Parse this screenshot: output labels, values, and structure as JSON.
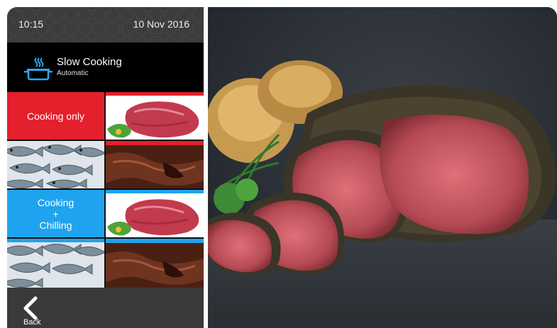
{
  "status": {
    "time": "10:15",
    "date": "10 Nov 2016"
  },
  "mode": {
    "icon": "pot-steam-icon",
    "title": "Slow Cooking",
    "subtitle": "Automatic"
  },
  "programs": [
    {
      "label": "Cooking only",
      "color": "#e3202c"
    },
    {
      "label_lines": [
        "Cooking",
        "+",
        "Chilling"
      ],
      "color": "#1fa3ef"
    }
  ],
  "tiles": [
    "beef-image",
    "fish-image",
    "chocolate-image"
  ],
  "back": {
    "label": "Back",
    "icon": "chevron-left-icon"
  },
  "colors": {
    "red": "#e3202c",
    "blue": "#1fa3ef"
  }
}
